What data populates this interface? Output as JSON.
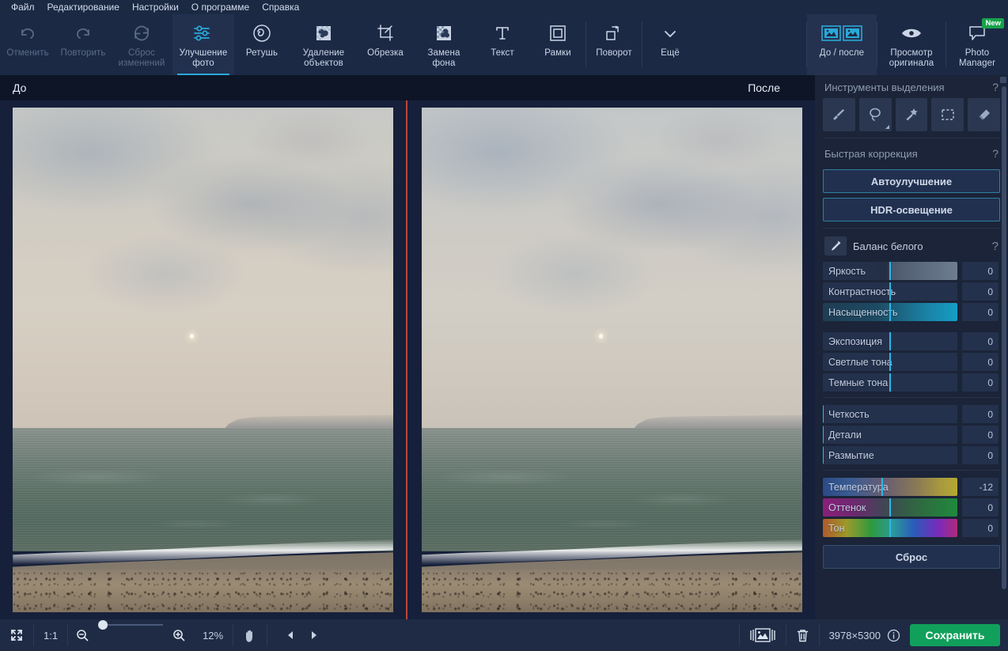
{
  "menu": {
    "items": [
      {
        "label": "Файл",
        "name": "menu-file"
      },
      {
        "label": "Редактирование",
        "name": "menu-edit"
      },
      {
        "label": "Настройки",
        "name": "menu-settings"
      },
      {
        "label": "О программе",
        "name": "menu-about"
      },
      {
        "label": "Справка",
        "name": "menu-help"
      }
    ]
  },
  "toolbar": {
    "undo": "Отменить",
    "redo": "Повторить",
    "reset_changes": "Сброс\nизменений",
    "reset_changes_l1": "Сброс",
    "reset_changes_l2": "изменений",
    "enhance_l1": "Улучшение",
    "enhance_l2": "фото",
    "retouch": "Ретушь",
    "remove_objects_l1": "Удаление",
    "remove_objects_l2": "объектов",
    "crop": "Обрезка",
    "bg_replace_l1": "Замена",
    "bg_replace_l2": "фона",
    "text": "Текст",
    "frames": "Рамки",
    "rotate": "Поворот",
    "more": "Ещё",
    "before_after": "До / после",
    "view_original_l1": "Просмотр",
    "view_original_l2": "оригинала",
    "photo_manager_l1": "Photo",
    "photo_manager_l2": "Manager",
    "photo_manager_badge": "New",
    "accent_color": "#2aa9d8"
  },
  "canvas": {
    "before_label": "До",
    "after_label": "После",
    "divider_color": "#c0443a"
  },
  "panel": {
    "selection_tools_title": "Инструменты выделения",
    "selection_tools_help": "?",
    "tools": [
      {
        "name": "brush-tool",
        "label": "Кисть"
      },
      {
        "name": "lasso-tool",
        "label": "Лассо"
      },
      {
        "name": "magic-wand-tool",
        "label": "Волшебная палочка"
      },
      {
        "name": "rect-select-tool",
        "label": "Прямоугольное выделение"
      },
      {
        "name": "eraser-tool",
        "label": "Ластик"
      }
    ],
    "quick_fix_title": "Быстрая коррекция",
    "quick_fix_help": "?",
    "auto_enhance": "Автоулучшение",
    "hdr_lighting": "HDR-освещение",
    "white_balance_title": "Баланс белого",
    "white_balance_help": "?",
    "reset": "Сброс",
    "sliders_group1": [
      {
        "label": "Яркость",
        "value": "0",
        "pos": 50,
        "grad": "linear-gradient(to right,#24314c,#242f46 48%,#4d5a6e 52%,#6f7d90)"
      },
      {
        "label": "Контрастность",
        "value": "0",
        "pos": 50,
        "grad": "linear-gradient(to right,#24314c,#24314c)"
      },
      {
        "label": "Насыщенность",
        "value": "0",
        "pos": 50,
        "grad": "linear-gradient(to right,#1f3d53,#1d4a63 40%,#1a7fa2 75%,#159ec6)"
      }
    ],
    "sliders_group2": [
      {
        "label": "Экспозиция",
        "value": "0",
        "pos": 50,
        "grad": "linear-gradient(to right,#24314c,#24314c)"
      },
      {
        "label": "Светлые тона",
        "value": "0",
        "pos": 50,
        "grad": "linear-gradient(to right,#24314c,#24314c)"
      },
      {
        "label": "Темные тона",
        "value": "0",
        "pos": 50,
        "grad": "linear-gradient(to right,#24314c,#24314c)"
      }
    ],
    "sliders_group3": [
      {
        "label": "Четкость",
        "value": "0",
        "pos": 0,
        "grad": "linear-gradient(to right,#24314c,#24314c)"
      },
      {
        "label": "Детали",
        "value": "0",
        "pos": 0,
        "grad": "linear-gradient(to right,#24314c,#24314c)"
      },
      {
        "label": "Размытие",
        "value": "0",
        "pos": 0,
        "grad": "linear-gradient(to right,#24314c,#24314c)"
      }
    ],
    "sliders_group4": [
      {
        "label": "Температура",
        "value": "-12",
        "pos": 44,
        "grad": "linear-gradient(to right,#2b4a86,#3a5c92 20%,#6b5f70 48%,#8a7a55 70%,#a89a3e 88%,#b5a832)"
      },
      {
        "label": "Оттенок",
        "value": "0",
        "pos": 50,
        "grad": "linear-gradient(to right,#8a1f7a,#6a2a6e 25%,#3b4a52 48%,#2f6a40 72%,#1f8a3c)"
      },
      {
        "label": "Тон",
        "value": "0",
        "pos": 50,
        "grad": "linear-gradient(to right,#b05a2a,#9a9a2a 18%,#2e9a3e 36%,#2a9a9a 52%,#2a5aba 68%,#7a2aba 86%,#b02a7a)"
      }
    ]
  },
  "statusbar": {
    "fit_icon": "fit-screen-icon",
    "actual_size": "1:1",
    "zoom_out_icon": "zoom-out-icon",
    "zoom_in_icon": "zoom-in-icon",
    "zoom_level": "12%",
    "hand_icon": "hand-tool-icon",
    "prev_icon": "previous-image-icon",
    "next_icon": "next-image-icon",
    "gallery_icon": "image-gallery-icon",
    "delete_icon": "trash-icon",
    "dimensions": "3978×5300",
    "info_icon": "info-icon",
    "save": "Сохранить",
    "save_color": "#11a05c",
    "zoom_knob_pos": 0
  }
}
